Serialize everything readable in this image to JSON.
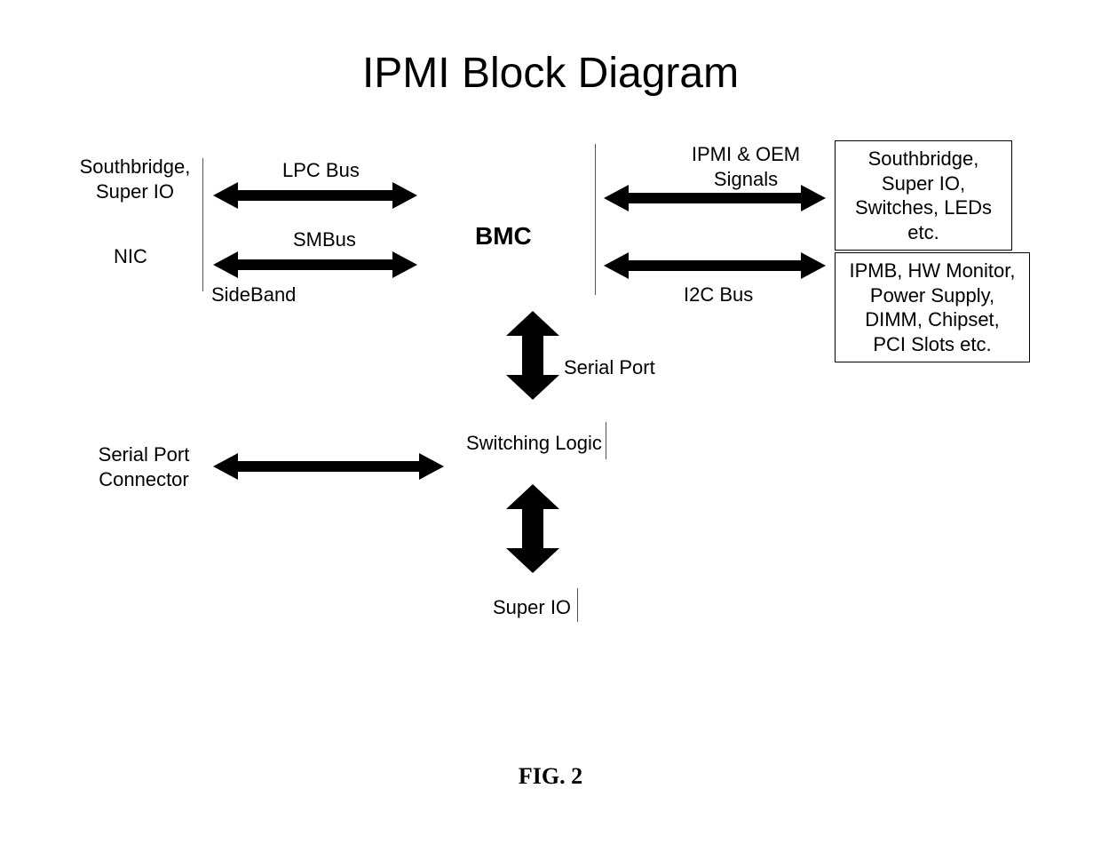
{
  "title": "IPMI Block Diagram",
  "center": {
    "bmc": "BMC"
  },
  "left": {
    "southbridge": "Southbridge,\nSuper IO",
    "nic": "NIC",
    "lpc": "LPC Bus",
    "smbus": "SMBus",
    "sideband": "SideBand",
    "serial_port_connector": "Serial Port\nConnector"
  },
  "right": {
    "ipmi_oem": "IPMI & OEM\nSignals",
    "southbridge_box": "Southbridge,\nSuper IO,\nSwitches, LEDs\netc.",
    "i2c": "I2C Bus",
    "ipmb_box": "IPMB, HW Monitor,\nPower Supply,\nDIMM, Chipset,\nPCI Slots etc."
  },
  "bottom": {
    "serial_port": "Serial Port",
    "switching_logic": "Switching Logic",
    "super_io": "Super IO"
  },
  "figure": "FIG. 2"
}
